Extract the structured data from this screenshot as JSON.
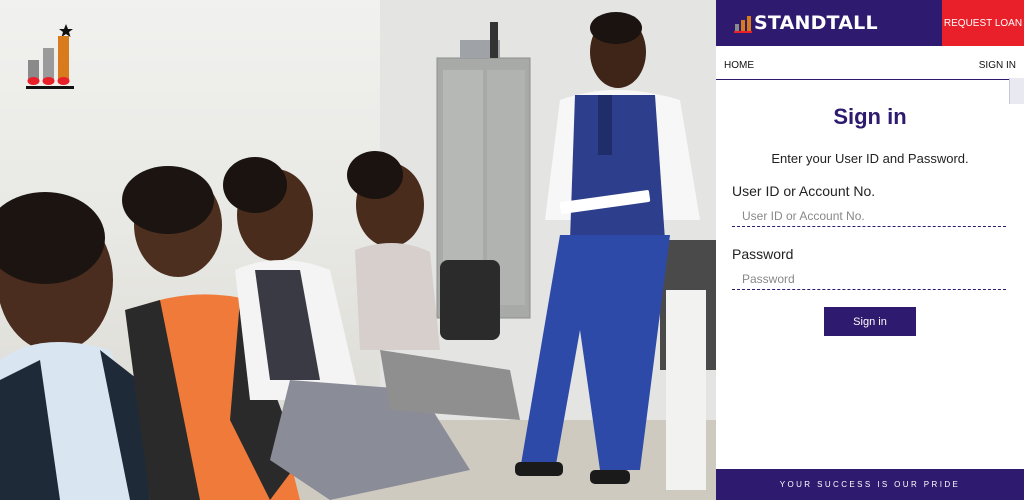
{
  "header": {
    "brand_name": "STANDTALL",
    "request_loan_label": "REQUEST LOAN"
  },
  "nav": {
    "home_label": "HOME",
    "signin_label": "SIGN IN"
  },
  "signin": {
    "title": "Sign in",
    "subtitle": "Enter your User ID and Password.",
    "user_label": "User ID or Account No.",
    "user_placeholder": "User ID or Account No.",
    "user_value": "",
    "password_label": "Password",
    "password_placeholder": "Password",
    "password_value": "",
    "submit_label": "Sign in"
  },
  "footer": {
    "tagline": "YOUR SUCCESS IS OUR PRIDE"
  },
  "colors": {
    "brand_purple": "#2e1a6e",
    "accent_red": "#e9202a",
    "logo_orange": "#d97a1c",
    "logo_gray": "#8a8a8a"
  },
  "icons": {
    "logo": "bar-chart-star-logo",
    "photo": "group-meeting-photo"
  }
}
